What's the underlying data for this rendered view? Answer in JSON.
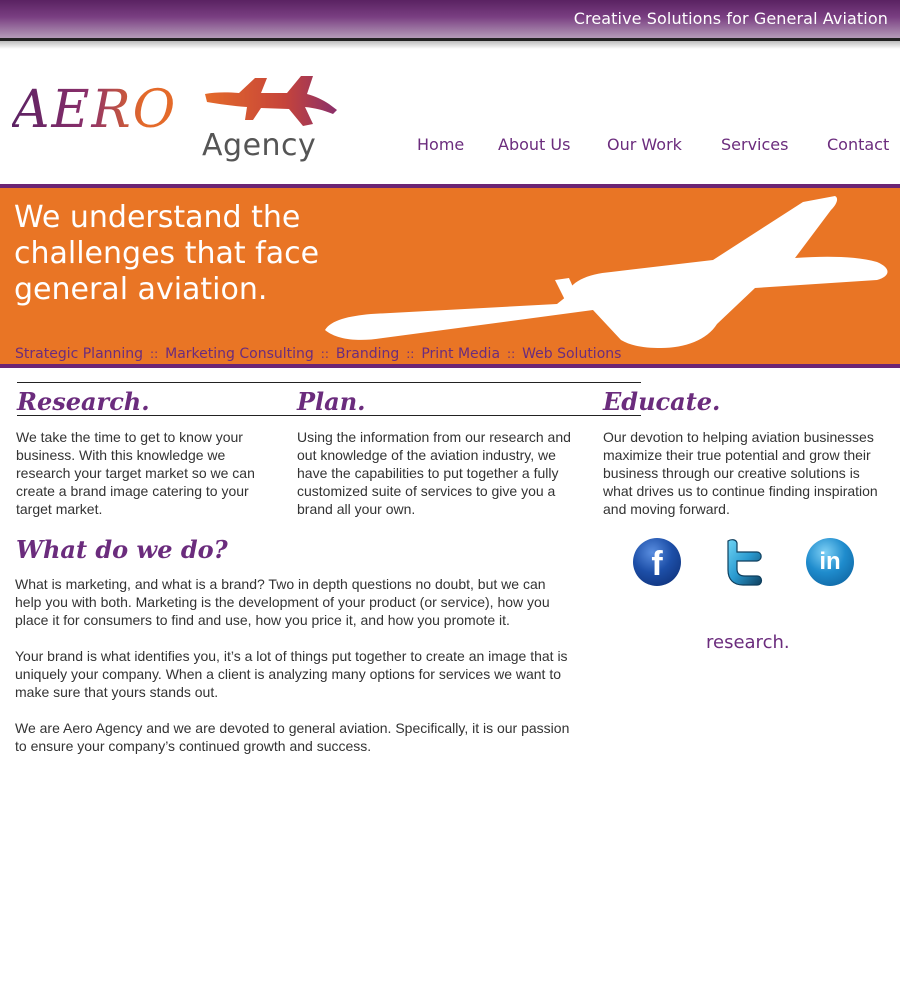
{
  "header": {
    "tagline": "Creative Solutions for General Aviation"
  },
  "logo": {
    "aero": "AERO",
    "agency": "Agency"
  },
  "nav": {
    "items": [
      "Home",
      "About Us",
      "Our Work",
      "Services",
      "Contact"
    ]
  },
  "hero": {
    "headline": "We understand the challenges that face general aviation.",
    "services": [
      "Strategic Planning",
      "Marketing Consulting",
      "Branding",
      "Print Media",
      "Web Solutions"
    ],
    "separator": "::"
  },
  "columns": [
    {
      "heading": "Research.",
      "text": "We take the time to get to know your business. With this knowledge we research your target market so we can create a brand image catering to your target market."
    },
    {
      "heading": "Plan.",
      "text": "Using the information from our research and out knowledge of the aviation industry, we have the capabilities to put together a fully customized suite of services to give you a brand all your own."
    },
    {
      "heading": "Educate.",
      "text": "Our devotion to helping aviation businesses maximize their true potential and grow their business through our creative solutions is what drives us to continue finding inspiration and moving forward."
    }
  ],
  "what_we_do": {
    "heading": "What do we do?",
    "paragraphs": [
      "What is marketing, and what is a brand? Two in depth questions no doubt, but we can help you with both. Marketing is the development of your product (or service), how you place it for consumers to find and use, how you price it, and how you promote it.",
      "Your brand is what identifies you, it’s a lot of things put together to create an image that is uniquely your company. When a client is analyzing many options for services we want to make sure that yours stands out.",
      "We are Aero Agency and we are devoted to general aviation. Specifically, it is our passion to ensure your company’s continued growth and success."
    ]
  },
  "social": {
    "icons": [
      "facebook-icon",
      "twitter-icon",
      "linkedin-icon"
    ],
    "facebook_glyph": "f",
    "linkedin_glyph": "in"
  },
  "sidebar_label": "research.",
  "colors": {
    "purple": "#6b2c7d",
    "orange": "#e97525",
    "hero_border": "#6b2473"
  }
}
